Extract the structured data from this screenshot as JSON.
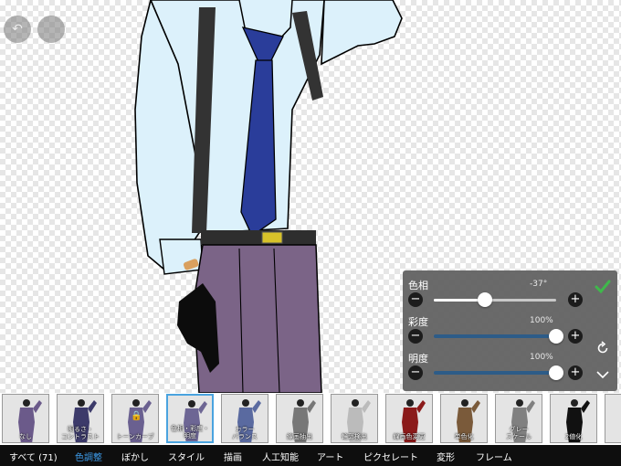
{
  "top_bar": {
    "status_right": "",
    "undo_icon": "undo-arrow-icon",
    "redo_icon": "redo-icon"
  },
  "adjust_panel": {
    "hue": {
      "label": "色相",
      "value": "-37°",
      "level": 0.42
    },
    "saturation": {
      "label": "彩度",
      "value": "100%",
      "level": 1.0
    },
    "brightness": {
      "label": "明度",
      "value": "100%",
      "level": 1.0
    },
    "confirm_icon": "checkmark-icon",
    "reset_icon": "reset-rotate-icon",
    "collapse_icon": "chevron-down-icon",
    "colors": {
      "confirm": "#3fb84b",
      "panel": "#5f5f5f",
      "track_fill": "#2d5c88"
    }
  },
  "filters": [
    {
      "label": "なし",
      "tint": "#6b5a8a"
    },
    {
      "label": "明るさ・\nコントラスト",
      "tint": "#3c3a6a"
    },
    {
      "label": "トーンカーブ",
      "tint": "#6a6090",
      "locked": true
    },
    {
      "label": "色相・彩度・\n明度",
      "tint": "#6d6694",
      "selected": true
    },
    {
      "label": "カラー\nバランス",
      "tint": "#5a6aa0"
    },
    {
      "label": "線画抽出",
      "tint": "#777777"
    },
    {
      "label": "輪郭検出",
      "tint": "#bbbbbb"
    },
    {
      "label": "線画色変更",
      "tint": "#8b1a1a"
    },
    {
      "label": "単色化",
      "tint": "#7a5a3a"
    },
    {
      "label": "グレー\nスケール",
      "tint": "#808080"
    },
    {
      "label": "2値化",
      "tint": "#111111"
    },
    {
      "label": "",
      "tint": "#555555"
    }
  ],
  "tabs": [
    {
      "label": "すべて (71)"
    },
    {
      "label": "色調整",
      "active": true
    },
    {
      "label": "ぼかし"
    },
    {
      "label": "スタイル"
    },
    {
      "label": "描画"
    },
    {
      "label": "人工知能"
    },
    {
      "label": "アート"
    },
    {
      "label": "ピクセレート"
    },
    {
      "label": "変形"
    },
    {
      "label": "フレーム"
    }
  ]
}
